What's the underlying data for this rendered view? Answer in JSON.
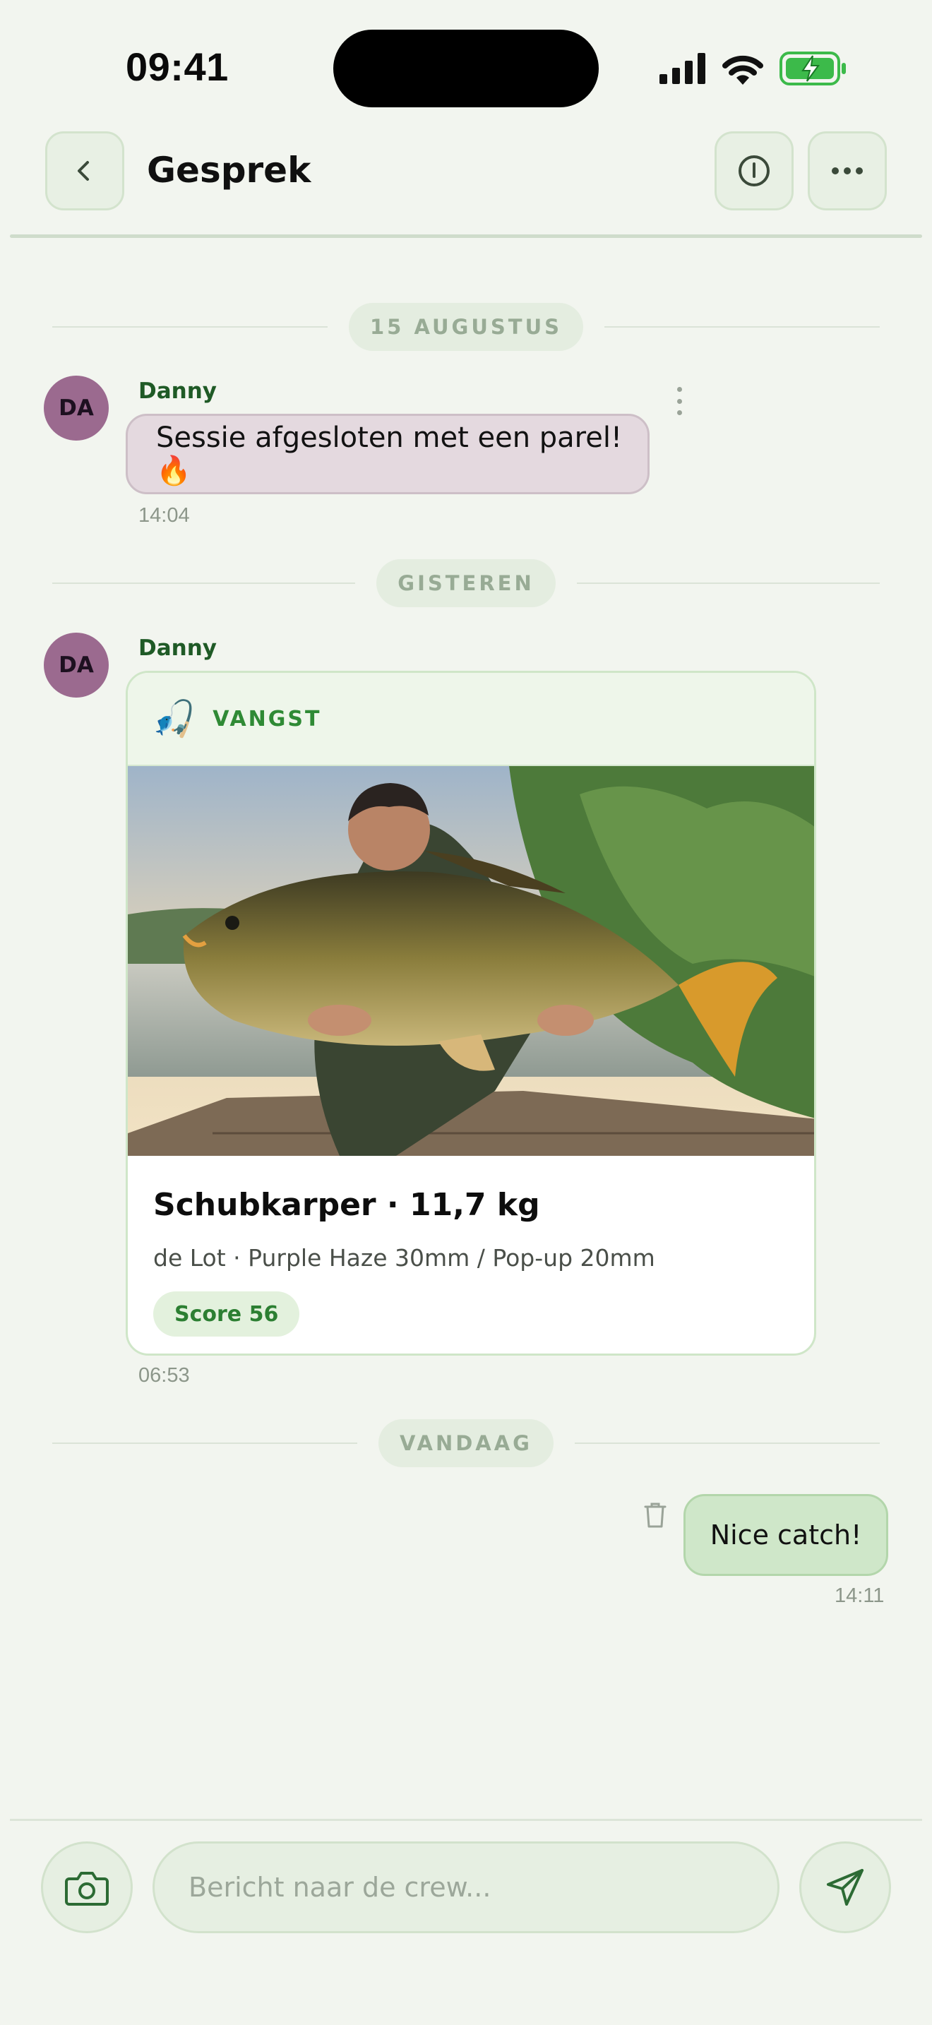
{
  "status_bar": {
    "time": "09:41"
  },
  "header": {
    "title": "Gesprek"
  },
  "separators": {
    "first": "15 AUGUSTUS",
    "second": "GISTEREN",
    "third": "VANDAAG"
  },
  "messages": [
    {
      "initials": "DA",
      "sender": "Danny",
      "text": "Sessie afgesloten met een parel! 🔥",
      "time": "14:04"
    },
    {
      "initials": "DA",
      "sender": "Danny",
      "time": "06:53",
      "card": {
        "emoji": "🎣",
        "label": "VANGST",
        "title": "Schubkarper · 11,7 kg",
        "subtitle": "de Lot · Purple Haze 30mm / Pop-up 20mm",
        "score": "Score 56"
      }
    },
    {
      "text": "Nice catch!",
      "time": "14:11",
      "outgoing": true
    }
  ],
  "composer": {
    "placeholder": "Bericht naar de crew..."
  },
  "colors": {
    "accent": "#2f8a35",
    "background": "#f2f5ef",
    "avatar": "#9b6a8f",
    "incoming": "#e4d9df",
    "outgoing": "#cfe7c9"
  },
  "icons": [
    "back-icon",
    "info-icon",
    "more-icon",
    "kebab-icon",
    "trash-icon",
    "camera-icon",
    "send-icon",
    "signal-icon",
    "wifi-icon",
    "battery-icon"
  ]
}
